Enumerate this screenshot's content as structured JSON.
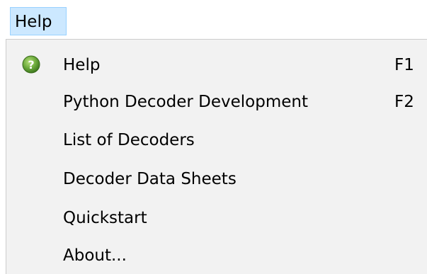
{
  "menubar": {
    "help_label": "Help"
  },
  "menu": {
    "items": [
      {
        "label": "Help",
        "shortcut": "F1",
        "icon": "help-circle-icon",
        "icon_color": "#5a9c2e"
      },
      {
        "label": "Python Decoder Development",
        "shortcut": "F2"
      },
      {
        "label": "List of Decoders"
      },
      {
        "label": "Decoder Data Sheets"
      },
      {
        "label": "Quickstart"
      },
      {
        "label": "About..."
      }
    ]
  }
}
